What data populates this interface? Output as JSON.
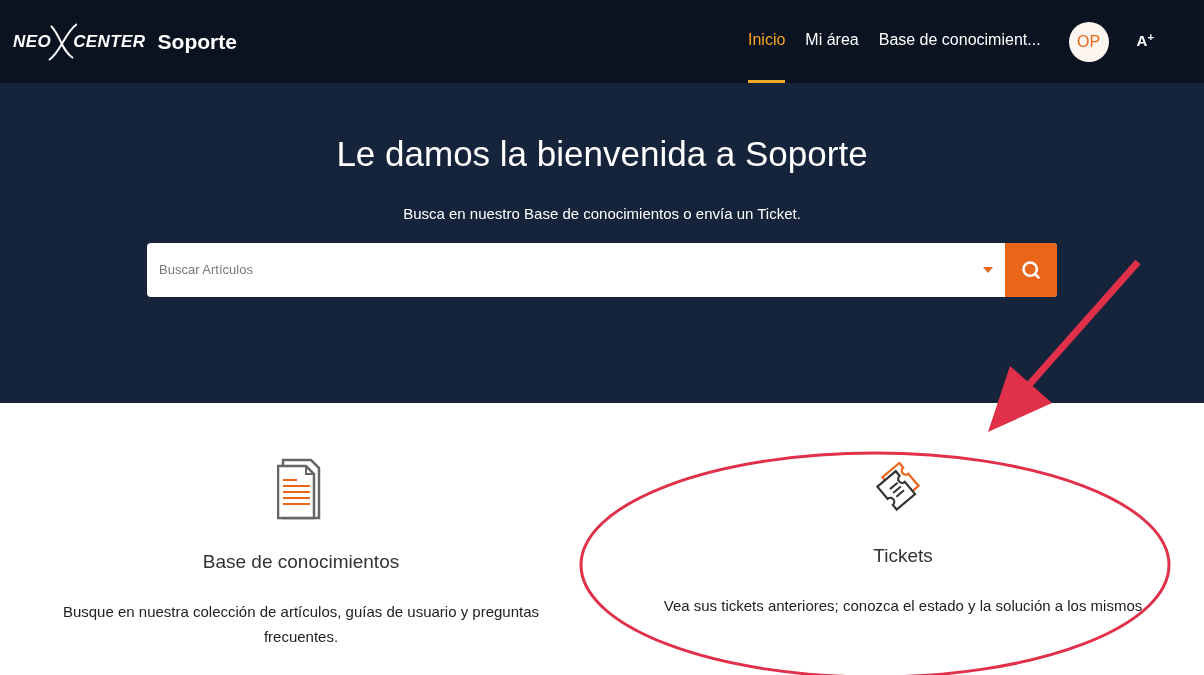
{
  "header": {
    "logo": {
      "left": "NEO",
      "right": "CENTER"
    },
    "brand": "Soporte",
    "nav": [
      {
        "label": "Inicio",
        "selected": true
      },
      {
        "label": "Mi área",
        "selected": false
      },
      {
        "label": "Base de conocimient...",
        "selected": false
      }
    ],
    "avatar": "OP",
    "font_size_toggle": "A$^{+}$"
  },
  "hero": {
    "title": "Le damos la bienvenida a Soporte",
    "subtitle": "Busca en nuestro Base de conocimientos o envía un Ticket.",
    "search": {
      "placeholder": "Buscar Artículos"
    }
  },
  "cards": [
    {
      "kind": "documents",
      "highlighted": false,
      "title": "Base de conocimientos",
      "description": "Busque en nuestra colección de artículos, guías de usuario y preguntas frecuentes."
    },
    {
      "kind": "tickets",
      "highlighted": true,
      "title": "Tickets",
      "description": "Vea sus tickets anteriores; conozca el estado y la solución a los mismos"
    }
  ]
}
